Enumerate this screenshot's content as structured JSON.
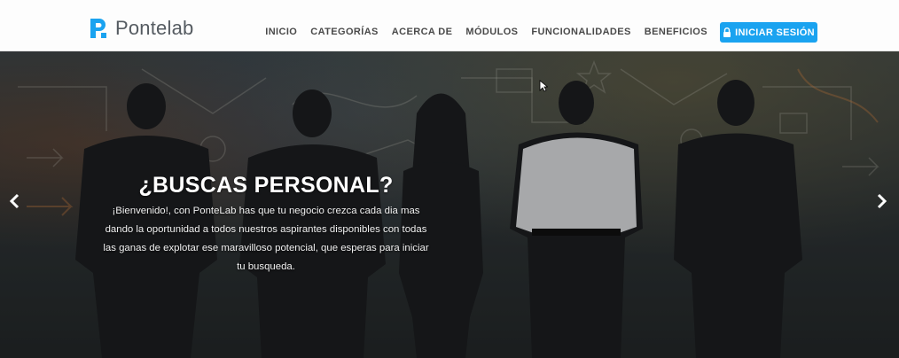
{
  "brand": {
    "name": "Pontelab",
    "color": "#1aa3f0",
    "logo_icon": "pontelab-logo-icon"
  },
  "nav": {
    "items": [
      {
        "label": "INICIO"
      },
      {
        "label": "CATEGORÍAS"
      },
      {
        "label": "ACERCA DE"
      },
      {
        "label": "MÓDULOS"
      },
      {
        "label": "FUNCIONALIDADES"
      },
      {
        "label": "BENEFICIOS"
      }
    ],
    "login_label": "INICIAR SESIÓN",
    "login_icon": "lock-icon"
  },
  "hero": {
    "title": "¿BUSCAS PERSONAL?",
    "lines": [
      "¡Bienvenido!, con PonteLab has que tu negocio crezca cada dia mas",
      "dando la oportunidad a todos nuestros aspirantes disponibles con todas",
      "las ganas de explotar ese maravilloso potencial, que esperas para iniciar",
      "tu busqueda."
    ],
    "prev_icon": "chevron-left-icon",
    "next_icon": "chevron-right-icon"
  }
}
